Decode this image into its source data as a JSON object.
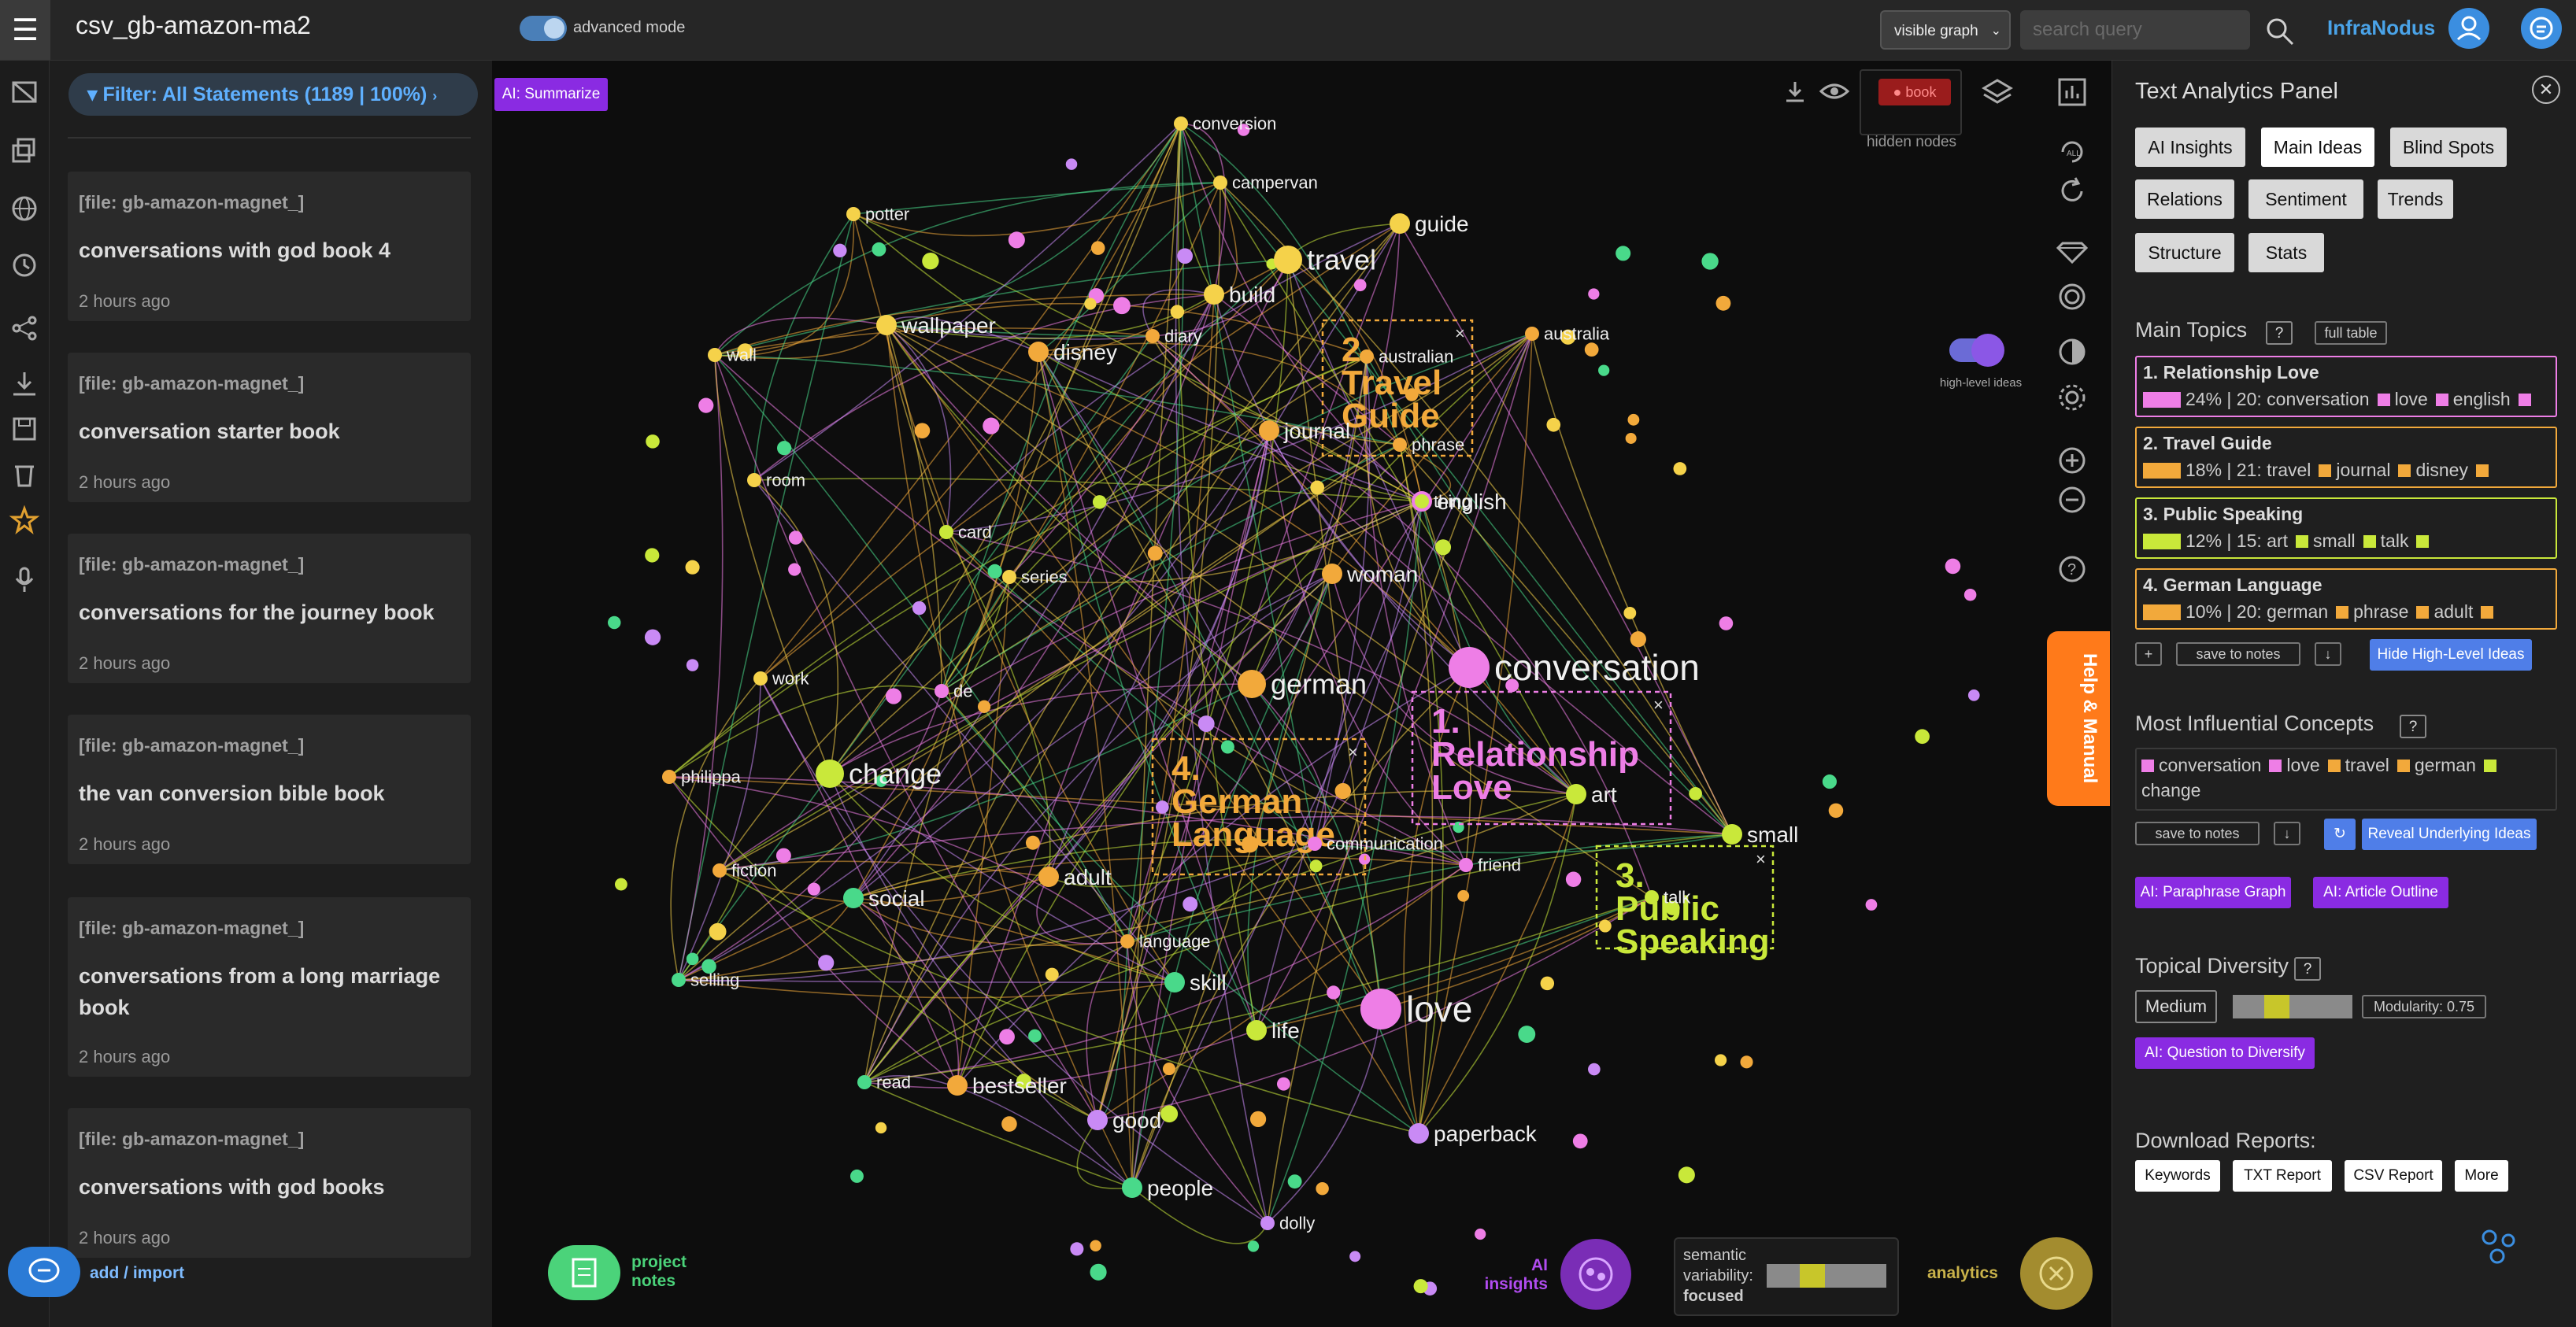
{
  "header": {
    "menu_icon": "hamburger-menu-icon",
    "title": "csv_gb-amazon-ma2",
    "mode_label": "advanced mode",
    "graph_select": "visible graph",
    "search_placeholder": "search query",
    "brand": "InfraNodus"
  },
  "statements": {
    "filter_label": "Filter: All Statements (1189 | 100%)",
    "ai_summarize": "AI: Summarize",
    "items": [
      {
        "file": "[file: gb-amazon-magnet_]",
        "title": "conversations with god book 4",
        "time": "2 hours ago"
      },
      {
        "file": "[file: gb-amazon-magnet_]",
        "title": "conversation starter book",
        "time": "2 hours ago"
      },
      {
        "file": "[file: gb-amazon-magnet_]",
        "title": "conversations for the journey book",
        "time": "2 hours ago"
      },
      {
        "file": "[file: gb-amazon-magnet_]",
        "title": "the van conversion bible book",
        "time": "2 hours ago"
      },
      {
        "file": "[file: gb-amazon-magnet_]",
        "title": "conversations from a long marriage book",
        "time": "2 hours ago"
      },
      {
        "file": "[file: gb-amazon-magnet_]",
        "title": "conversations with god books",
        "time": "2 hours ago"
      }
    ],
    "add_import": "add / import"
  },
  "graph": {
    "hidden_tag": "book",
    "hidden_label": "hidden nodes",
    "highlevel_label": "high-level ideas",
    "colors": {
      "orange": "#f2a93b",
      "yellow": "#f5d24a",
      "pink": "#ee7ee6",
      "green": "#49d98a",
      "lime": "#c9e83a",
      "violet": "#c98af5"
    },
    "nodes": [
      {
        "id": "conversion",
        "label": "conversion",
        "c": "yellow",
        "r": 1
      },
      {
        "id": "campervan",
        "label": "campervan",
        "c": "yellow",
        "r": 1
      },
      {
        "id": "potter",
        "label": "potter",
        "c": "yellow",
        "r": 1
      },
      {
        "id": "guide",
        "label": "guide",
        "c": "yellow",
        "r": 2
      },
      {
        "id": "travel",
        "label": "travel",
        "c": "yellow",
        "r": 3
      },
      {
        "id": "build",
        "label": "build",
        "c": "yellow",
        "r": 2
      },
      {
        "id": "wallpaper",
        "label": "wallpaper",
        "c": "yellow",
        "r": 2
      },
      {
        "id": "wall",
        "label": "wall",
        "c": "yellow",
        "r": 1
      },
      {
        "id": "disney",
        "label": "disney",
        "c": "orange",
        "r": 2
      },
      {
        "id": "diary",
        "label": "diary",
        "c": "orange",
        "r": 1
      },
      {
        "id": "australian",
        "label": "australian",
        "c": "orange",
        "r": 1
      },
      {
        "id": "australia",
        "label": "australia",
        "c": "orange",
        "r": 1
      },
      {
        "id": "journal",
        "label": "journal",
        "c": "orange",
        "r": 2
      },
      {
        "id": "phrase",
        "label": "phrase",
        "c": "orange",
        "r": 1
      },
      {
        "id": "room",
        "label": "room",
        "c": "yellow",
        "r": 1
      },
      {
        "id": "english",
        "label": "english",
        "c": "pink",
        "r": 2
      },
      {
        "id": "thing",
        "label": "thing",
        "c": "lime",
        "r": 1
      },
      {
        "id": "card",
        "label": "card",
        "c": "lime",
        "r": 1
      },
      {
        "id": "series",
        "label": "series",
        "c": "yellow",
        "r": 1
      },
      {
        "id": "woman",
        "label": "woman",
        "c": "orange",
        "r": 2
      },
      {
        "id": "work",
        "label": "work",
        "c": "yellow",
        "r": 1
      },
      {
        "id": "de",
        "label": "de",
        "c": "pink",
        "r": 1
      },
      {
        "id": "german",
        "label": "german",
        "c": "orange",
        "r": 3
      },
      {
        "id": "conversation",
        "label": "conversation",
        "c": "pink",
        "r": 4
      },
      {
        "id": "philippa",
        "label": "philippa",
        "c": "orange",
        "r": 1
      },
      {
        "id": "change",
        "label": "change",
        "c": "lime",
        "r": 3
      },
      {
        "id": "art",
        "label": "art",
        "c": "lime",
        "r": 2
      },
      {
        "id": "small",
        "label": "small",
        "c": "lime",
        "r": 2
      },
      {
        "id": "fiction",
        "label": "fiction",
        "c": "orange",
        "r": 1
      },
      {
        "id": "communication",
        "label": "communication",
        "c": "pink",
        "r": 1
      },
      {
        "id": "friend",
        "label": "friend",
        "c": "pink",
        "r": 1
      },
      {
        "id": "social",
        "label": "social",
        "c": "green",
        "r": 2
      },
      {
        "id": "adult",
        "label": "adult",
        "c": "orange",
        "r": 2
      },
      {
        "id": "talk",
        "label": "talk",
        "c": "lime",
        "r": 1
      },
      {
        "id": "selling",
        "label": "selling",
        "c": "green",
        "r": 1
      },
      {
        "id": "language",
        "label": "language",
        "c": "orange",
        "r": 1
      },
      {
        "id": "skill",
        "label": "skill",
        "c": "green",
        "r": 2
      },
      {
        "id": "life",
        "label": "life",
        "c": "lime",
        "r": 2
      },
      {
        "id": "love",
        "label": "love",
        "c": "pink",
        "r": 4
      },
      {
        "id": "read",
        "label": "read",
        "c": "green",
        "r": 1
      },
      {
        "id": "bestseller",
        "label": "bestseller",
        "c": "orange",
        "r": 2
      },
      {
        "id": "good",
        "label": "good",
        "c": "violet",
        "r": 2
      },
      {
        "id": "paperback",
        "label": "paperback",
        "c": "violet",
        "r": 2
      },
      {
        "id": "people",
        "label": "people",
        "c": "green",
        "r": 2
      },
      {
        "id": "dolly",
        "label": "dolly",
        "c": "violet",
        "r": 1
      }
    ],
    "clusters": [
      {
        "id": "c1",
        "label": "1. Relationship Love",
        "c": "pink"
      },
      {
        "id": "c2",
        "label": "2. Travel Guide",
        "c": "orange"
      },
      {
        "id": "c3",
        "label": "3. Public Speaking",
        "c": "lime"
      },
      {
        "id": "c4",
        "label": "4. German Language",
        "c": "orange"
      }
    ],
    "project_notes": "project notes",
    "ai_insights": "AI insights",
    "variability_label": "semantic variability:",
    "variability_value": "focused",
    "analytics": "analytics"
  },
  "help_tab": "Help & Manual",
  "panel": {
    "title": "Text Analytics Panel",
    "tabs": [
      "AI Insights",
      "Main Ideas",
      "Blind Spots",
      "Relations",
      "Sentiment",
      "Trends",
      "Structure",
      "Stats"
    ],
    "active_tab": "Main Ideas",
    "main_topics_title": "Main Topics",
    "help_mark": "?",
    "full_table": "full table",
    "topics": [
      {
        "name": "1. Relationship Love",
        "pct": "24% | 20:",
        "words": [
          "conversation",
          "love",
          "english"
        ],
        "color": "#ee7ee6"
      },
      {
        "name": "2. Travel Guide",
        "pct": "18% | 21:",
        "words": [
          "travel",
          "journal",
          "disney"
        ],
        "color": "#f2a93b"
      },
      {
        "name": "3. Public Speaking",
        "pct": "12% | 15:",
        "words": [
          "art",
          "small",
          "talk"
        ],
        "color": "#c9e83a"
      },
      {
        "name": "4. German Language",
        "pct": "10% | 20:",
        "words": [
          "german",
          "phrase",
          "adult"
        ],
        "color": "#f2a93b"
      }
    ],
    "plus": "+",
    "save_notes": "save to notes",
    "download_arrow": "↓",
    "hide_highlevel": "Hide High-Level Ideas",
    "influential_title": "Most Influential Concepts",
    "influential": [
      {
        "w": "conversation",
        "c": "#ee7ee6"
      },
      {
        "w": "love",
        "c": "#ee7ee6"
      },
      {
        "w": "travel",
        "c": "#f2a93b"
      },
      {
        "w": "german",
        "c": "#f2a93b"
      },
      {
        "w": "change",
        "c": "#c9e83a"
      }
    ],
    "reveal_label": "Reveal Underlying Ideas",
    "paraphrase": "AI: Paraphrase Graph",
    "outline": "AI: Article Outline",
    "diversity_title": "Topical Diversity",
    "diversity_value": "Medium",
    "modularity": "Modularity: 0.75",
    "diversify": "AI: Question to Diversify",
    "download_title": "Download Reports:",
    "reports": [
      "Keywords",
      "TXT Report",
      "CSV Report",
      "More"
    ]
  }
}
